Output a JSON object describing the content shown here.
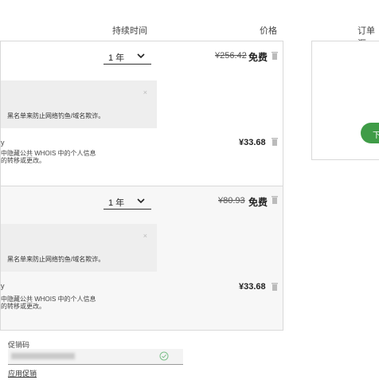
{
  "header": {
    "duration_label": "持续时间",
    "price_label": "价格",
    "summary_label": "订单汇"
  },
  "items": [
    {
      "duration": "1 年",
      "old_price": "¥256.42",
      "free": "免费",
      "notice": "黑名单来防止网络钓鱼/域名欺诈。",
      "privacy_tail": "y",
      "privacy_line1": "中隐藏公共 WHOIS 中的个人信息",
      "privacy_line2": "的转移或更改。",
      "privacy_price": "¥33.68"
    },
    {
      "duration": "1 年",
      "old_price": "¥80.93",
      "free": "免费",
      "notice": "黑名单来防止网络钓鱼/域名欺诈。",
      "privacy_tail": "y",
      "privacy_line1": "中隐藏公共 WHOIS 中的个人信息",
      "privacy_line2": "的转移或更改。",
      "privacy_price": "¥33.68"
    }
  ],
  "promo": {
    "label": "促销码",
    "apply": "应用促销"
  },
  "summary": {
    "button": "下"
  },
  "colors": {
    "accent": "#3f9c47",
    "panel": "#eeeeee",
    "section2": "#f7f7f7",
    "border": "#d9d9d9"
  }
}
